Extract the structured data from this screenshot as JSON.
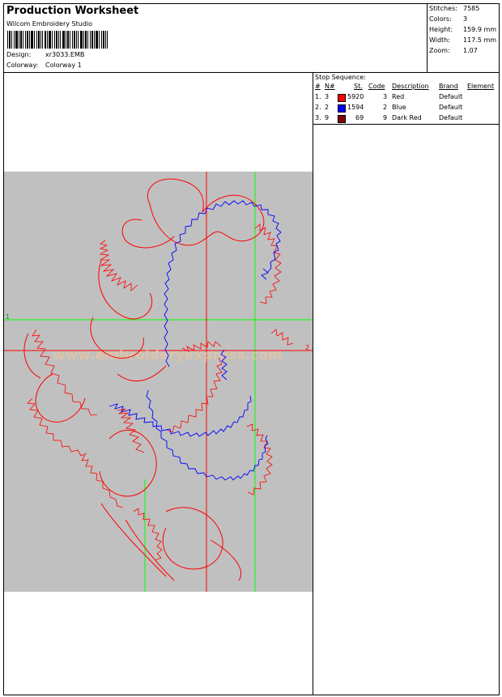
{
  "header": {
    "title": "Production Worksheet",
    "software": "Wilcom Embroidery Studio",
    "design_label": "Design:",
    "design_value": "xr3033.EMB",
    "colorway_label": "Colorway:",
    "colorway_value": "Colorway 1"
  },
  "stats": {
    "stitches_label": "Stitches:",
    "stitches": "7585",
    "colors_label": "Colors:",
    "colors": "3",
    "height_label": "Height:",
    "height": "159.9 mm",
    "width_label": "Width:",
    "width": "117.5 mm",
    "zoom_label": "Zoom:",
    "zoom": "1.07"
  },
  "stop_sequence": {
    "title": "Stop Sequence:",
    "headers": [
      "#",
      "N#",
      "St.",
      "Code",
      "Description",
      "Brand",
      "Element"
    ],
    "rows": [
      {
        "num": "1.",
        "n": "3",
        "st": "5920",
        "code": "3",
        "description": "Red",
        "brand": "Default",
        "color": "#ff0000"
      },
      {
        "num": "2.",
        "n": "2",
        "st": "1594",
        "code": "2",
        "description": "Blue",
        "brand": "Default",
        "color": "#0000ff"
      },
      {
        "num": "3.",
        "n": "9",
        "st": "69",
        "code": "9",
        "description": "Dark Red",
        "brand": "Default",
        "color": "#800000"
      }
    ]
  },
  "canvas": {
    "marker_1": "1",
    "marker_2": "2",
    "background": "#c0c0c0",
    "guide_color": "#00ff00",
    "red_thread": "#ff0000",
    "blue_thread": "#0000ff",
    "watermark": "www.embroideryexpress.com"
  }
}
